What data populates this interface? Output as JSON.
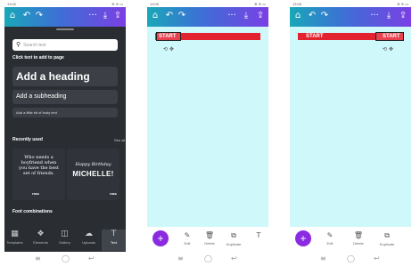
{
  "status": {
    "time_p1": "13:00",
    "time_p2": "13:06",
    "time_p3": "13:06",
    "icons": "⊕ ≋ ▭"
  },
  "topbar_icons": {
    "home": "⌂",
    "undo": "↶",
    "redo": "↷",
    "more": "···",
    "download": "⤓",
    "share": "⇪"
  },
  "panel1": {
    "search_placeholder": "Search text",
    "click_hint": "Click text to add to page",
    "add_heading": "Add a heading",
    "add_subheading": "Add a subheading",
    "add_body": "Add a little bit of body text",
    "recently_used": "Recently used",
    "see_all": "See all",
    "card1": {
      "text": "Who needs a boyfriend when you have the best set of friends.",
      "badge": "FREE"
    },
    "card2": {
      "line1": "Happy Birthday",
      "line2": "MICHELLE!",
      "badge": "FREE"
    },
    "font_combinations": "Font combinations",
    "tabs": [
      {
        "label": "Templates",
        "icon": "▦"
      },
      {
        "label": "Elements",
        "icon": "❖"
      },
      {
        "label": "Gallery",
        "icon": "◫"
      },
      {
        "label": "Uploads",
        "icon": "☁"
      },
      {
        "label": "Text",
        "icon": "T"
      }
    ]
  },
  "panel2": {
    "band_text": "START",
    "controls": "⟲ ✥"
  },
  "panel3": {
    "band_left": "START",
    "band_right": "START",
    "controls": "⟲ ✥"
  },
  "bottom_tools": [
    {
      "label": "Edit",
      "icon": "✎"
    },
    {
      "label": "Delete",
      "icon": "🗑"
    },
    {
      "label": "Duplicate",
      "icon": "⧉"
    },
    {
      "label": "T",
      "icon": "T"
    }
  ],
  "fab": "+",
  "sysnav": {
    "menu": "≡",
    "home": "◯",
    "back": "↩"
  },
  "colors": {
    "canvas": "#cff8fb",
    "accent": "#8a2be2",
    "band": "#e3222f",
    "panel": "#2a2e33"
  }
}
